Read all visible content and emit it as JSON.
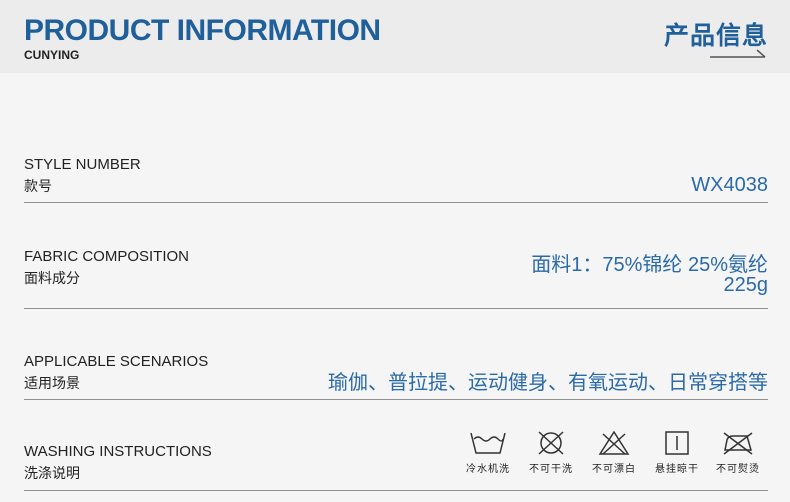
{
  "header": {
    "title": "PRODUCT INFORMATION",
    "subtitle": "CUNYING",
    "title_cn": "产品信息"
  },
  "rows": [
    {
      "label_en": "STYLE NUMBER",
      "label_cn": "款号",
      "value": "WX4038"
    },
    {
      "label_en": "FABRIC COMPOSITION",
      "label_cn": "面料成分",
      "value_line1": "面料1：75%锦纶 25%氨纶",
      "value_line2": "225g"
    },
    {
      "label_en": "APPLICABLE SCENARIOS",
      "label_cn": "适用场景",
      "value": "瑜伽、普拉提、运动健身、有氧运动、日常穿搭等"
    },
    {
      "label_en": "WASHING INSTRUCTIONS",
      "label_cn": "洗涤说明"
    }
  ],
  "washing_icons": [
    {
      "icon": "cold-wash-icon",
      "label": "冷水机洗"
    },
    {
      "icon": "no-dry-clean-icon",
      "label": "不可干洗"
    },
    {
      "icon": "no-bleach-icon",
      "label": "不可漂白"
    },
    {
      "icon": "hang-dry-icon",
      "label": "悬挂晾干"
    },
    {
      "icon": "no-iron-icon",
      "label": "不可熨烫"
    }
  ],
  "colors": {
    "accent": "#1f5f9a",
    "value_text": "#2a6aa8",
    "background": "#f5f5f5"
  }
}
